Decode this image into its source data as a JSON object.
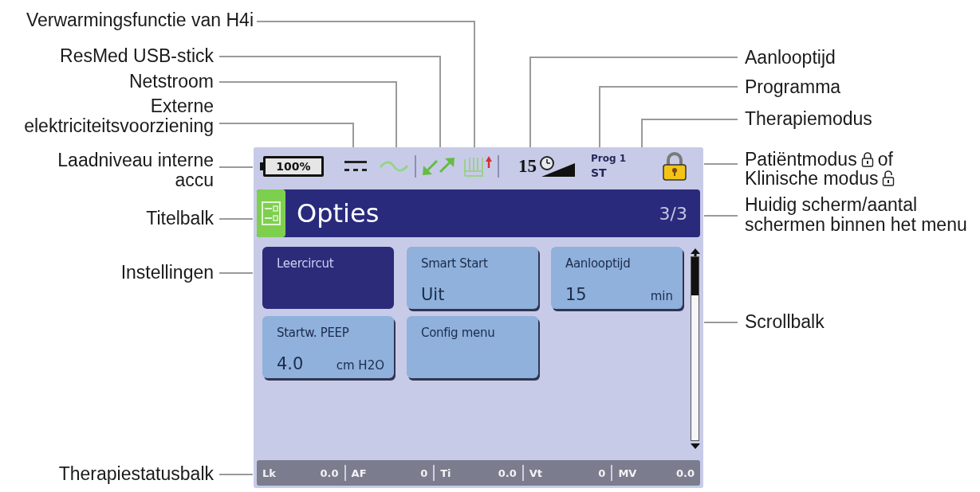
{
  "left_callouts": [
    {
      "text": "Verwarmingsfunctie van H4i"
    },
    {
      "text": "ResMed USB-stick"
    },
    {
      "text": "Netstroom"
    },
    {
      "text": "Externe elektriciteitsvoorziening"
    },
    {
      "text": "Laadniveau interne accu"
    },
    {
      "text": "Titelbalk"
    },
    {
      "text": "Instellingen"
    },
    {
      "text": "Therapiestatusbalk"
    }
  ],
  "screen": {
    "status_row": {
      "battery": "100%",
      "ramp_time": "15",
      "program": "Prog 1",
      "mode": "ST",
      "locked": true
    },
    "title_bar": {
      "title": "Opties",
      "page": "3/3"
    },
    "tiles": [
      {
        "label": "Leercircut",
        "selected": true
      },
      {
        "label": "Smart Start",
        "value": "Uit",
        "selected": false
      },
      {
        "label": "Aanlooptijd",
        "value": "15",
        "unit": "min",
        "selected": false
      },
      {
        "label": "Startw. PEEP",
        "value": "4.0",
        "unit": "cm H2O",
        "selected": false
      },
      {
        "label": "Config menu",
        "selected": false
      }
    ],
    "therapy_status_bar": [
      {
        "label": "Lk",
        "value": "0.0"
      },
      {
        "label": "AF",
        "value": "0"
      },
      {
        "label": "Ti",
        "value": "0.0"
      },
      {
        "label": "Vt",
        "value": "0"
      },
      {
        "label": "MV",
        "value": "0.0"
      }
    ]
  },
  "right_callouts": [
    {
      "kind": "text",
      "text": "Aanlooptijd"
    },
    {
      "kind": "text",
      "text": "Programma"
    },
    {
      "kind": "text",
      "text": "Therapiemodus"
    },
    {
      "kind": "lock_modes",
      "patient_mode": "Patiëntmodus",
      "joiner": "of",
      "clinical_mode": "Klinische modus"
    },
    {
      "kind": "text",
      "text": "Huidig scherm/aantal schermen binnen het menu"
    },
    {
      "kind": "text",
      "text": "Scrollbalk"
    }
  ]
}
